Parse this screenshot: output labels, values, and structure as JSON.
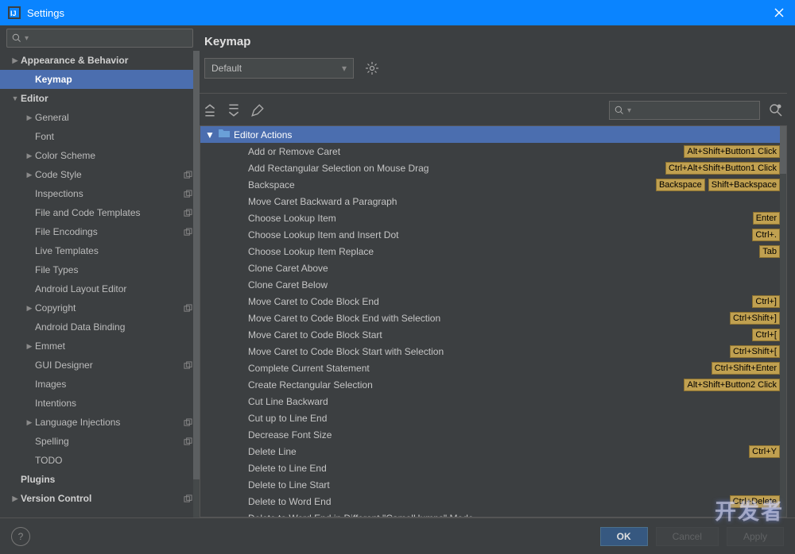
{
  "titlebar": {
    "title": "Settings"
  },
  "sidebar": {
    "search_placeholder": "",
    "items": [
      {
        "label": "Appearance & Behavior",
        "level": 0,
        "exp": "▶",
        "top": true
      },
      {
        "label": "Keymap",
        "level": 1,
        "top": true,
        "selected": true
      },
      {
        "label": "Editor",
        "level": 0,
        "exp": "▼",
        "top": true
      },
      {
        "label": "General",
        "level": 1,
        "exp": "▶"
      },
      {
        "label": "Font",
        "level": 1
      },
      {
        "label": "Color Scheme",
        "level": 1,
        "exp": "▶"
      },
      {
        "label": "Code Style",
        "level": 1,
        "exp": "▶",
        "ov": true
      },
      {
        "label": "Inspections",
        "level": 1,
        "ov": true
      },
      {
        "label": "File and Code Templates",
        "level": 1,
        "ov": true
      },
      {
        "label": "File Encodings",
        "level": 1,
        "ov": true
      },
      {
        "label": "Live Templates",
        "level": 1
      },
      {
        "label": "File Types",
        "level": 1
      },
      {
        "label": "Android Layout Editor",
        "level": 1
      },
      {
        "label": "Copyright",
        "level": 1,
        "exp": "▶",
        "ov": true
      },
      {
        "label": "Android Data Binding",
        "level": 1
      },
      {
        "label": "Emmet",
        "level": 1,
        "exp": "▶"
      },
      {
        "label": "GUI Designer",
        "level": 1,
        "ov": true
      },
      {
        "label": "Images",
        "level": 1
      },
      {
        "label": "Intentions",
        "level": 1
      },
      {
        "label": "Language Injections",
        "level": 1,
        "exp": "▶",
        "ov": true
      },
      {
        "label": "Spelling",
        "level": 1,
        "ov": true
      },
      {
        "label": "TODO",
        "level": 1
      },
      {
        "label": "Plugins",
        "level": 0,
        "top": true
      },
      {
        "label": "Version Control",
        "level": 0,
        "exp": "▶",
        "top": true,
        "ov": true
      }
    ]
  },
  "main": {
    "title": "Keymap",
    "scheme_dropdown": "Default",
    "group_title": "Editor Actions",
    "actions": [
      {
        "name": "Add or Remove Caret",
        "shortcuts": [
          "Alt+Shift+Button1 Click"
        ]
      },
      {
        "name": "Add Rectangular Selection on Mouse Drag",
        "shortcuts": [
          "Ctrl+Alt+Shift+Button1 Click"
        ]
      },
      {
        "name": "Backspace",
        "shortcuts": [
          "Backspace",
          "Shift+Backspace"
        ]
      },
      {
        "name": "Move Caret Backward a Paragraph",
        "shortcuts": []
      },
      {
        "name": "Choose Lookup Item",
        "shortcuts": [
          "Enter"
        ]
      },
      {
        "name": "Choose Lookup Item and Insert Dot",
        "shortcuts": [
          "Ctrl+."
        ]
      },
      {
        "name": "Choose Lookup Item Replace",
        "shortcuts": [
          "Tab"
        ]
      },
      {
        "name": "Clone Caret Above",
        "shortcuts": []
      },
      {
        "name": "Clone Caret Below",
        "shortcuts": []
      },
      {
        "name": "Move Caret to Code Block End",
        "shortcuts": [
          "Ctrl+]"
        ]
      },
      {
        "name": "Move Caret to Code Block End with Selection",
        "shortcuts": [
          "Ctrl+Shift+]"
        ]
      },
      {
        "name": "Move Caret to Code Block Start",
        "shortcuts": [
          "Ctrl+["
        ]
      },
      {
        "name": "Move Caret to Code Block Start with Selection",
        "shortcuts": [
          "Ctrl+Shift+["
        ]
      },
      {
        "name": "Complete Current Statement",
        "shortcuts": [
          "Ctrl+Shift+Enter"
        ]
      },
      {
        "name": "Create Rectangular Selection",
        "shortcuts": [
          "Alt+Shift+Button2 Click"
        ]
      },
      {
        "name": "Cut Line Backward",
        "shortcuts": []
      },
      {
        "name": "Cut up to Line End",
        "shortcuts": []
      },
      {
        "name": "Decrease Font Size",
        "shortcuts": []
      },
      {
        "name": "Delete Line",
        "shortcuts": [
          "Ctrl+Y"
        ]
      },
      {
        "name": "Delete to Line End",
        "shortcuts": []
      },
      {
        "name": "Delete to Line Start",
        "shortcuts": []
      },
      {
        "name": "Delete to Word End",
        "shortcuts": [
          "Ctrl+Delete"
        ]
      },
      {
        "name": "Delete to Word End in Different \"CamelHumps\" Mode",
        "shortcuts": []
      }
    ]
  },
  "footer": {
    "ok": "OK",
    "cancel": "Cancel",
    "apply": "Apply"
  },
  "watermark": "开发者"
}
